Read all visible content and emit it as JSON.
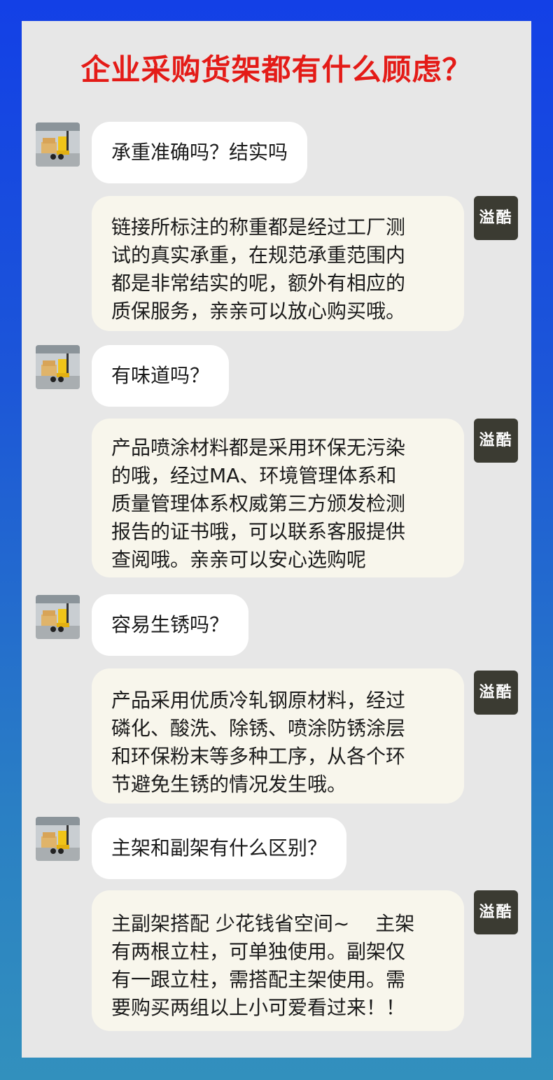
{
  "title": "企业采购货架都有什么顾虑？",
  "badge_label": "溢酷",
  "qa": [
    {
      "question": "承重准确吗？结实吗",
      "answer_lines": [
        "链接所标注的称重都是经过工厂测",
        "试的真实承重，在规范承重范围内",
        "都是非常结实的呢，额外有相应的",
        "质保服务，亲亲可以放心购买哦。"
      ]
    },
    {
      "question": "有味道吗？",
      "answer_lines": [
        "产品喷涂材料都是采用环保无污染",
        "的哦，经过MA、环境管理体系和",
        "质量管理体系权威第三方颁发检测",
        "报告的证书哦，可以联系客服提供",
        "查阅哦。亲亲可以安心选购呢"
      ]
    },
    {
      "question": "容易生锈吗？",
      "answer_lines": [
        "产品采用优质冷轧钢原材料，经过",
        "磷化、酸洗、除锈、喷涂防锈涂层",
        "和环保粉末等多种工序，从各个环",
        "节避免生锈的情况发生哦。"
      ]
    },
    {
      "question": "主架和副架有什么区别？",
      "answer_lines": [
        "主副架搭配 少花钱省空间~　 主架",
        "有两根立柱，可单独使用。副架仅",
        "有一跟立柱，需搭配主架使用。需",
        "要购买两组以上小可爱看过来！！"
      ]
    }
  ],
  "colors": {
    "title": "#e41b17",
    "question_bubble": "#ffffff",
    "answer_bubble": "#f8f6ec",
    "badge": "#3b3b32"
  },
  "icons": {
    "avatar": "forklift-icon"
  }
}
